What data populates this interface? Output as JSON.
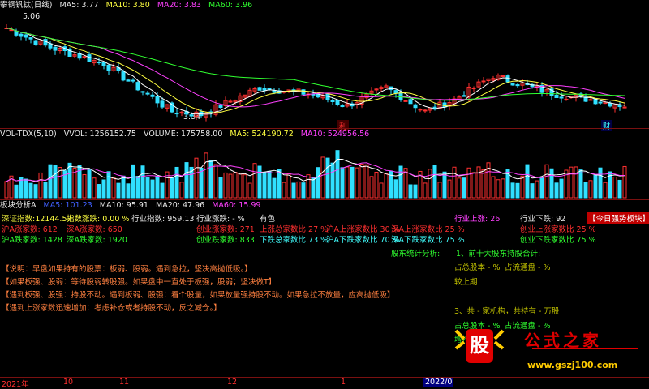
{
  "main_header": {
    "title": "攀钢钒钛(日线)",
    "ma5": "MA5: 3.77",
    "ma10": "MA10: 3.80",
    "ma20": "MA20: 3.83",
    "ma60": "MA60: 3.96",
    "high_label": "5.06",
    "low_label": "3.34",
    "marker_1": "利",
    "marker_2": "财"
  },
  "vol_header": {
    "name": "VOL-TDX(5,10)",
    "vvol": "VVOL: 1256152.75",
    "volume": "VOLUME: 175758.00",
    "ma5": "MA5: 524190.72",
    "ma10": "MA10: 524956.56"
  },
  "board_header": {
    "name": "板块分析A",
    "ma5": "MA5: 101.23",
    "ma10": "MA10: 95.91",
    "ma20": "MA20: 47.96",
    "ma60": "MA60: 15.99"
  },
  "stats": {
    "r1_a": "深证指数:12144.57",
    "r1_b": "指数涨跌: 0.00 %",
    "r1_c": "行业指数: 959.13",
    "r1_d": "行业涨跌: - %",
    "r1_e": "有色",
    "r1_f": "行业上涨: 26",
    "r1_g": "行业下跌: 92",
    "r1_h": "【今日强势板块】: 纸",
    "r2_a": "沪A涨家数: 612",
    "r2_b": "深A涨家数: 650",
    "r2_c": "创业涨家数: 271",
    "r2_d": "上涨总家数比 27 %",
    "r2_e": "沪A上涨家数比 30 %",
    "r2_f": "深A上涨家数比 25 %",
    "r2_g": "创业上涨家数比 25 %",
    "r3_a": "沪A跌家数: 1428",
    "r3_b": "深A跌家数: 1920",
    "r3_c": "创业跌家数: 833",
    "r3_d": "下跌总家数比 73 %",
    "r3_e": "沪A下跌家数比 70 %",
    "r3_f": "深A下跌家数比 75 %",
    "r3_g": "创业下跌家数比 75 %"
  },
  "holders": {
    "title": "股东统计分析:",
    "l1": "1、前十大股东持股合计:",
    "l2a": "占总股本 - %",
    "l2b": "占流通盘 - %",
    "l3": "较上期",
    "l4": "3、共 - 家机构，共持有 - 万股",
    "l5a": "占总股本 - %",
    "l5b": "占流通盘 - %",
    "l6": "增持 - %"
  },
  "notes": [
    "【说明：早盘如果持有的股票：板弱、股弱。遇到急拉，坚决高抛低吸。】",
    "【如果板强、股弱：等待股弱转股强。如果盘中一直处于板强，股弱；坚决做T】",
    "【遇到板强、股强：持股不动。遇到板弱、股强：看个股量，如果放量强持股不动。如果急拉不放量，应高抛低吸】",
    "【遇到上涨家数迅速增加：考虑补仓或者持股不动，反之减仓。】"
  ],
  "time_axis": [
    "2021年",
    "10",
    "11",
    "12",
    "1",
    "2022/0"
  ],
  "watermark": {
    "badge": "股",
    "title": "公式之家",
    "url": "www.gszj100.com"
  },
  "colors": {
    "up": "#ff3030",
    "down": "#30e0ff",
    "ma5": "#ffffff",
    "ma10": "#ffff40",
    "ma20": "#ff40ff",
    "ma60": "#30ff30"
  }
}
